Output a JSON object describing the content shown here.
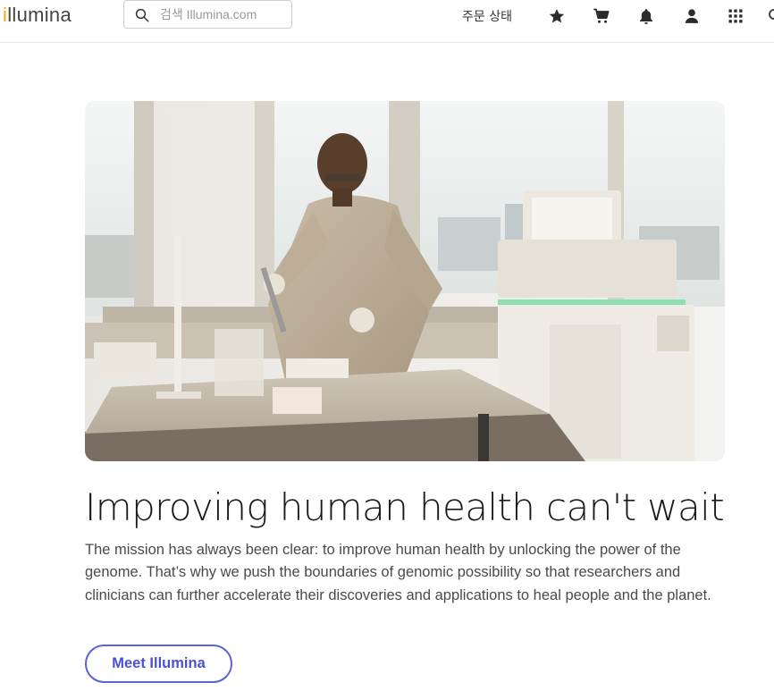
{
  "header": {
    "logo_prefix": "i",
    "logo_rest": "llumina",
    "search_placeholder": "검색 Illumina.com",
    "order_status": "주문 상태",
    "icons": [
      "star-icon",
      "cart-icon",
      "bell-icon",
      "user-icon",
      "apps-grid-icon"
    ]
  },
  "hero": {
    "image_alt": "Scientist pipetting samples in a laboratory next to a sequencing instrument"
  },
  "main": {
    "title": "Improving human health can't wait",
    "description": "The mission has always been clear: to improve human health by unlocking the power of the genome. That’s why we push the boundaries of genomic possibility so that researchers and clinicians can further accelerate their discoveries and applications to heal people and the planet.",
    "cta_label": "Meet Illumina"
  },
  "colors": {
    "logo_accent": "#f2a900",
    "cta": "#4a52d1"
  }
}
